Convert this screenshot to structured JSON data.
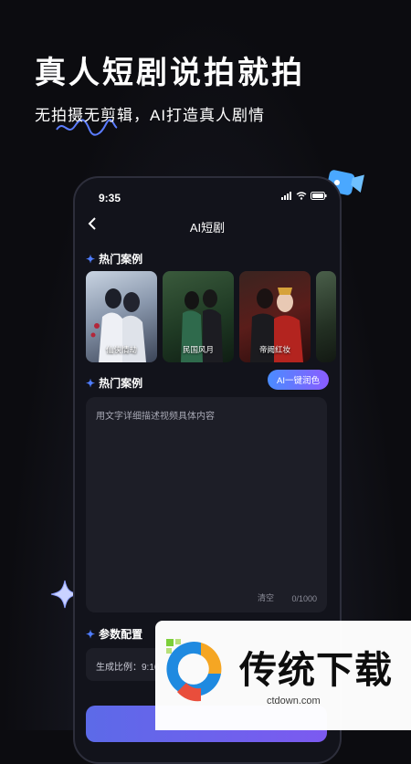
{
  "hero": {
    "title": "真人短剧说拍就拍",
    "subtitle": "无拍摄无剪辑，AI打造真人剧情"
  },
  "status_bar": {
    "time": "9:35"
  },
  "nav": {
    "title": "AI短剧",
    "back_icon": "chevron-left-icon"
  },
  "hot_cases": {
    "heading": "热门案例",
    "items": [
      {
        "label": "仙侠情劫"
      },
      {
        "label": "民国风月"
      },
      {
        "label": "帝阙红妆"
      },
      {
        "label": ""
      }
    ]
  },
  "prompt_section": {
    "heading": "热门案例",
    "ai_button": "AI一键润色",
    "placeholder": "用文字详细描述视频具体内容",
    "clear": "清空",
    "counter": "0/1000"
  },
  "params": {
    "heading": "参数配置",
    "ratio": "生成比例：9:16"
  },
  "watermark": {
    "brand": "传统下载",
    "url": "ctdown.com"
  },
  "colors": {
    "accent": "#4f7dff",
    "gradient_start": "#4a8cff",
    "gradient_end": "#8a5cff"
  }
}
